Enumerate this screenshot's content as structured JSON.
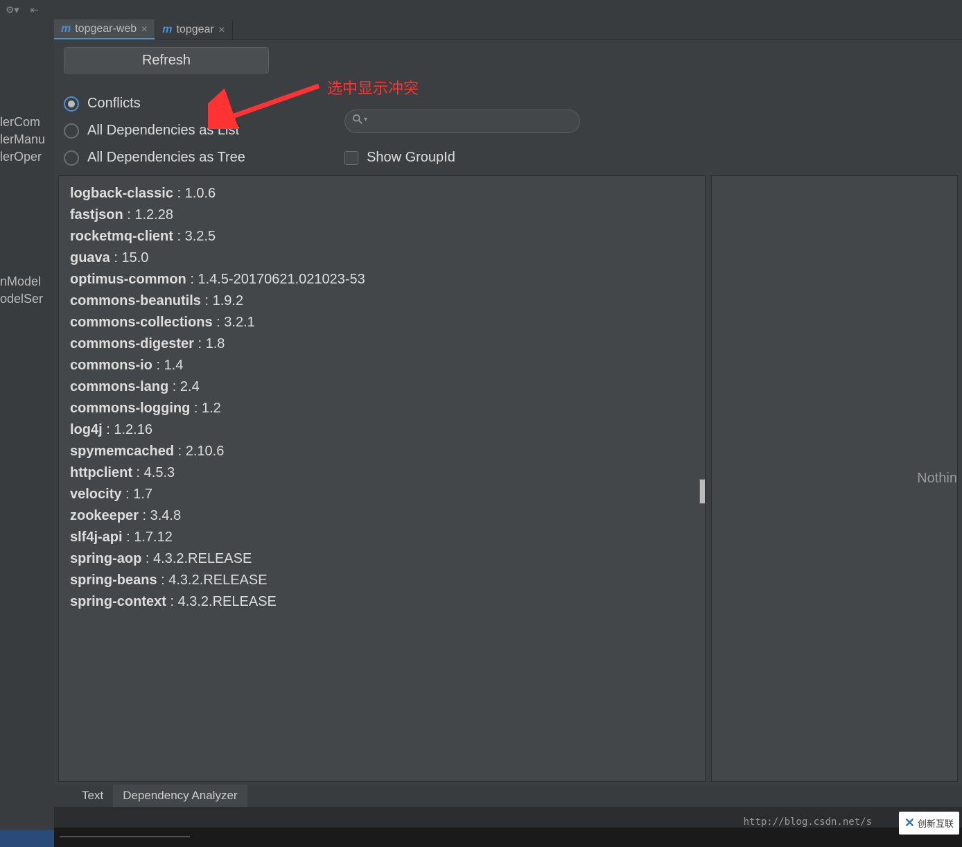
{
  "tabs": [
    {
      "label": "topgear-web",
      "active": true
    },
    {
      "label": "topgear",
      "active": false
    }
  ],
  "controls": {
    "refresh_label": "Refresh",
    "radios": {
      "conflicts": "Conflicts",
      "all_list": "All Dependencies as List",
      "all_tree": "All Dependencies as Tree"
    },
    "search_placeholder": "",
    "show_groupid_label": "Show GroupId"
  },
  "annotation_text": "选中显示冲突",
  "dependencies": [
    {
      "name": "logback-classic",
      "version": "1.0.6"
    },
    {
      "name": "fastjson",
      "version": "1.2.28"
    },
    {
      "name": "rocketmq-client",
      "version": "3.2.5"
    },
    {
      "name": "guava",
      "version": "15.0"
    },
    {
      "name": "optimus-common",
      "version": "1.4.5-20170621.021023-53"
    },
    {
      "name": "commons-beanutils",
      "version": "1.9.2"
    },
    {
      "name": "commons-collections",
      "version": "3.2.1"
    },
    {
      "name": "commons-digester",
      "version": "1.8"
    },
    {
      "name": "commons-io",
      "version": "1.4"
    },
    {
      "name": "commons-lang",
      "version": "2.4"
    },
    {
      "name": "commons-logging",
      "version": "1.2"
    },
    {
      "name": "log4j",
      "version": "1.2.16"
    },
    {
      "name": "spymemcached",
      "version": "2.10.6"
    },
    {
      "name": "httpclient",
      "version": "4.5.3"
    },
    {
      "name": "velocity",
      "version": "1.7"
    },
    {
      "name": "zookeeper",
      "version": "3.4.8"
    },
    {
      "name": "slf4j-api",
      "version": "1.7.12"
    },
    {
      "name": "spring-aop",
      "version": "4.3.2.RELEASE"
    },
    {
      "name": "spring-beans",
      "version": "4.3.2.RELEASE"
    },
    {
      "name": "spring-context",
      "version": "4.3.2.RELEASE"
    }
  ],
  "right_panel_text": "Nothin",
  "bottom_tabs": {
    "text": "Text",
    "analyzer": "Dependency Analyzer"
  },
  "sidebar_fragments": {
    "a": "lerCom",
    "b": "lerManu",
    "c": "lerOper",
    "d": "nModel",
    "e": "odelSer"
  },
  "watermark_url": "http://blog.csdn.net/s",
  "watermark_logo": "创新互联"
}
